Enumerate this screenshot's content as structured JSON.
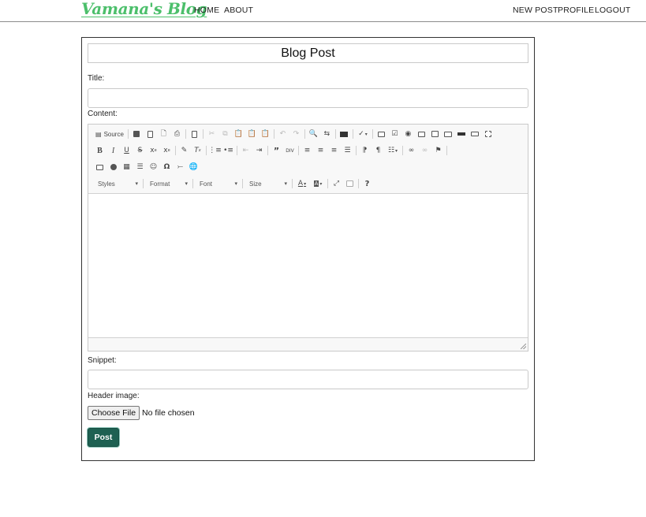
{
  "nav": {
    "brand": "Vamana's Blog",
    "left_links": [
      "HOME",
      "ABOUT"
    ],
    "right_links": [
      "NEW POST",
      "PROFILE",
      "LOGOUT"
    ]
  },
  "form": {
    "heading": "Blog Post",
    "title_label": "Title:",
    "title_value": "",
    "content_label": "Content:",
    "snippet_label": "Snippet:",
    "snippet_value": "",
    "header_image_label": "Header image:",
    "choose_file_label": "Choose File",
    "file_status": "No file chosen",
    "submit_label": "Post"
  },
  "editor": {
    "source_label": "Source",
    "combos": [
      "Styles",
      "Format",
      "Font",
      "Size"
    ],
    "rows": [
      [
        "source",
        "|",
        "save-icon",
        "new-page-icon",
        "preview-icon",
        "print-icon",
        "|",
        "templates-icon",
        "|",
        "cut-icon",
        "copy-icon",
        "paste-icon",
        "paste-text-icon",
        "paste-word-icon",
        "|",
        "undo-icon",
        "redo-icon",
        "|",
        "find-icon",
        "replace-icon",
        "|",
        "select-all-icon",
        "|",
        "spellcheck-icon",
        "|",
        "form-icon",
        "checkbox-icon",
        "radio-icon",
        "textfield-icon",
        "textarea-icon",
        "select-icon",
        "button-icon",
        "image-button-icon",
        "hidden-field-icon"
      ],
      [
        "bold-icon",
        "italic-icon",
        "underline-icon",
        "strike-icon",
        "subscript-icon",
        "superscript-icon",
        "|",
        "copy-format-icon",
        "remove-format-icon",
        "|",
        "numbered-list-icon",
        "bulleted-list-icon",
        "|",
        "outdent-icon",
        "indent-icon",
        "|",
        "blockquote-icon",
        "div-icon",
        "|",
        "align-left-icon",
        "align-center-icon",
        "align-right-icon",
        "justify-icon",
        "|",
        "ltr-icon",
        "rtl-icon",
        "language-icon",
        "|",
        "link-icon",
        "unlink-icon",
        "anchor-icon",
        "|"
      ],
      [
        "image-icon",
        "flash-icon",
        "table-icon",
        "horizontal-rule-icon",
        "smiley-icon",
        "special-char-icon",
        "page-break-icon",
        "iframe-icon"
      ],
      [
        "combos",
        "|",
        "text-color-icon",
        "bg-color-icon",
        "|",
        "maximize-icon",
        "show-blocks-icon",
        "|",
        "about-icon"
      ]
    ]
  }
}
